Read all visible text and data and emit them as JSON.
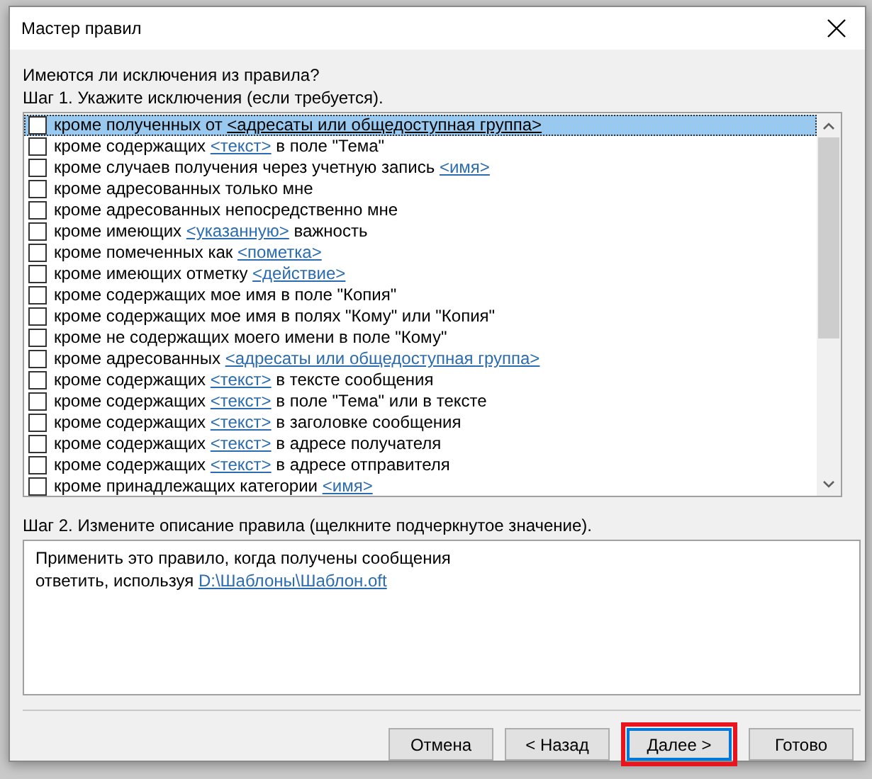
{
  "window": {
    "title": "Мастер правил"
  },
  "question": "Имеются ли исключения из правила?",
  "step1": {
    "label": "Шаг 1. Укажите исключения (если требуется).",
    "items": [
      {
        "before": "кроме полученных от ",
        "link": "<адресаты или общедоступная группа>",
        "checked": false,
        "selected": true
      },
      {
        "before": "кроме содержащих ",
        "link": "<текст>",
        "after": " в поле \"Тема\"",
        "checked": false,
        "selected": false
      },
      {
        "before": "кроме случаев получения через учетную запись ",
        "link": "<имя>",
        "checked": false,
        "selected": false
      },
      {
        "before": "кроме адресованных только мне",
        "checked": false,
        "selected": false
      },
      {
        "before": "кроме адресованных непосредственно мне",
        "checked": false,
        "selected": false
      },
      {
        "before": "кроме имеющих ",
        "link": "<указанную>",
        "after": " важность",
        "checked": false,
        "selected": false
      },
      {
        "before": "кроме помеченных как ",
        "link": "<пометка>",
        "checked": false,
        "selected": false
      },
      {
        "before": "кроме имеющих отметку ",
        "link": "<действие>",
        "checked": false,
        "selected": false
      },
      {
        "before": "кроме содержащих мое имя в поле \"Копия\"",
        "checked": false,
        "selected": false
      },
      {
        "before": "кроме содержащих мое имя в полях \"Кому\" или \"Копия\"",
        "checked": false,
        "selected": false
      },
      {
        "before": "кроме не содержащих моего имени в поле \"Кому\"",
        "checked": false,
        "selected": false
      },
      {
        "before": "кроме адресованных ",
        "link": "<адресаты или общедоступная группа>",
        "checked": false,
        "selected": false
      },
      {
        "before": "кроме содержащих ",
        "link": "<текст>",
        "after": " в тексте сообщения",
        "checked": false,
        "selected": false
      },
      {
        "before": "кроме содержащих ",
        "link": "<текст>",
        "after": " в поле \"Тема\" или в тексте",
        "checked": false,
        "selected": false
      },
      {
        "before": "кроме содержащих ",
        "link": "<текст>",
        "after": " в заголовке сообщения",
        "checked": false,
        "selected": false
      },
      {
        "before": "кроме содержащих ",
        "link": "<текст>",
        "after": " в адресе получателя",
        "checked": false,
        "selected": false
      },
      {
        "before": "кроме содержащих ",
        "link": "<текст>",
        "after": " в адресе отправителя",
        "checked": false,
        "selected": false
      },
      {
        "before": "кроме принадлежащих категории ",
        "link": "<имя>",
        "checked": false,
        "selected": false
      }
    ]
  },
  "step2": {
    "label": "Шаг 2. Измените описание правила (щелкните подчеркнутое значение).",
    "lines": [
      {
        "before": "Применить это правило, когда получены сообщения"
      },
      {
        "before": "ответить, используя ",
        "link": "D:\\Шаблоны\\Шаблон.oft"
      }
    ]
  },
  "buttons": [
    {
      "label": "Отмена",
      "highlighted": false
    },
    {
      "label": "< Назад",
      "highlighted": false
    },
    {
      "label": "Далее >",
      "highlighted": true
    },
    {
      "label": "Готово",
      "highlighted": false
    }
  ]
}
